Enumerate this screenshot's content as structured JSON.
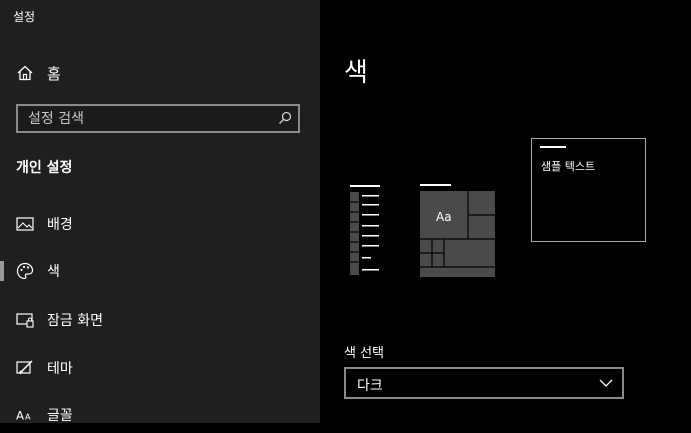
{
  "app": {
    "title": "설정"
  },
  "sidebar": {
    "home_label": "홈",
    "search": {
      "placeholder": "설정 검색"
    },
    "section_title": "개인 설정",
    "items": [
      {
        "label": "배경",
        "icon": "image-icon",
        "selected": false
      },
      {
        "label": "색",
        "icon": "palette-icon",
        "selected": true
      },
      {
        "label": "잠금 화면",
        "icon": "lock-screen-icon",
        "selected": false
      },
      {
        "label": "테마",
        "icon": "theme-brush-icon",
        "selected": false
      },
      {
        "label": "글꼴",
        "icon": "font-icon",
        "selected": false
      }
    ]
  },
  "main": {
    "title": "색",
    "preview": {
      "sample_text": "샘플 텍스트",
      "tile_label": "Aa"
    },
    "color_select": {
      "label": "색 선택",
      "value": "다크"
    }
  },
  "colors": {
    "sidebar_bg": "#1f1f1f",
    "content_bg": "#000000",
    "border": "#8a8a8a",
    "tile_gray": "#4a4a4a",
    "text": "#ffffff"
  }
}
